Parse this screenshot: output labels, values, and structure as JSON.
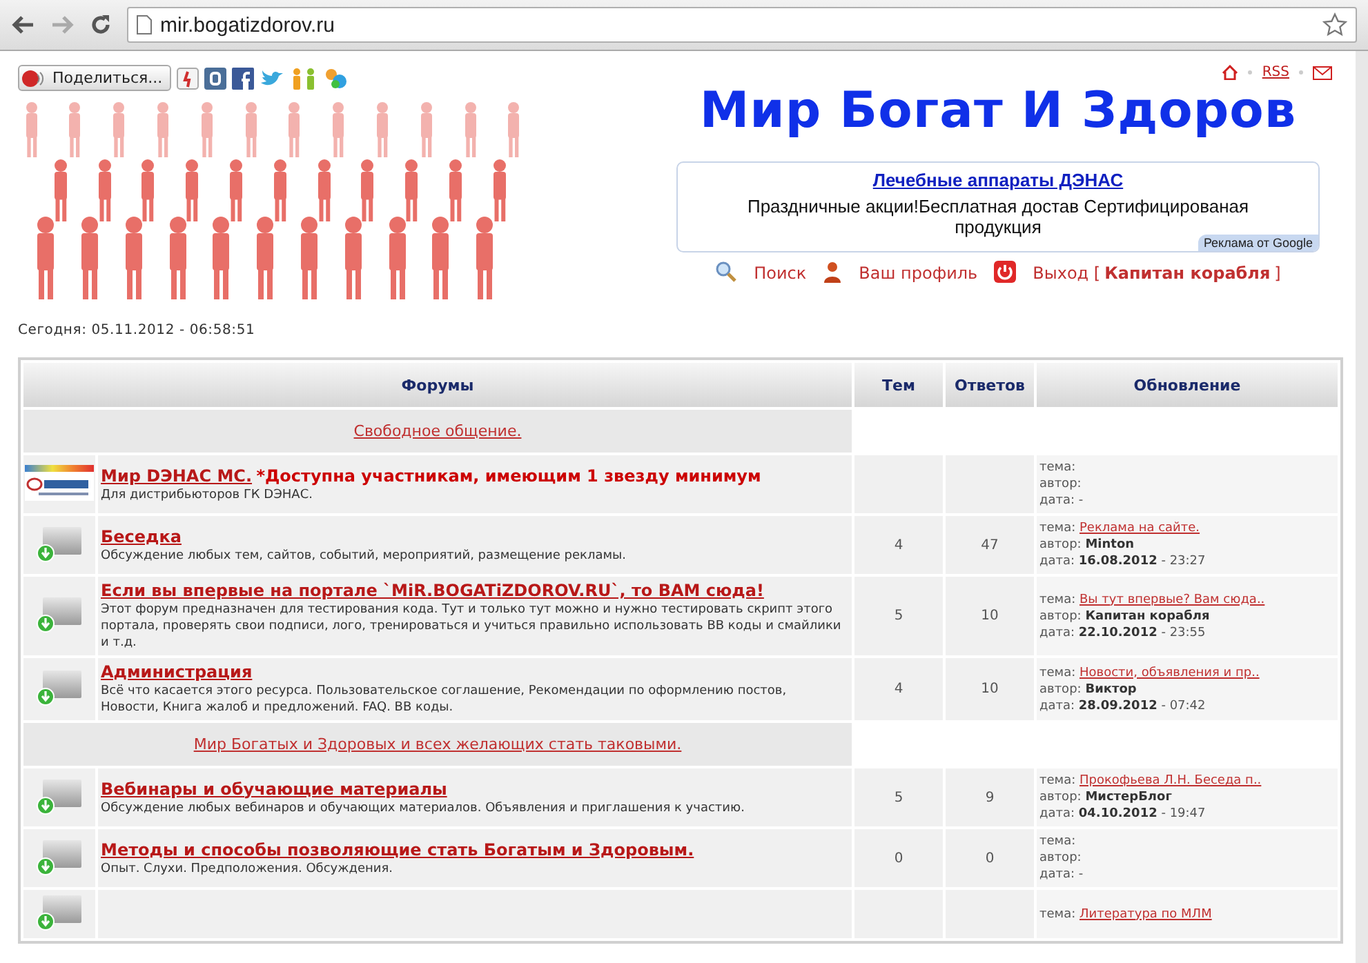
{
  "browser": {
    "url": "mir.bogatizdorov.ru"
  },
  "header": {
    "share_button": "Поделиться...",
    "date": "Сегодня: 05.11.2012 - 06:58:51",
    "rss": "RSS",
    "site_title": "Мир Богат И Здоров",
    "ad": {
      "title": "Лечебные аппараты ДЭНАС",
      "text": "Праздничные акции!Бесплатная достав Сертифицированая продукция",
      "badge": "Реклама от Google"
    },
    "user_links": [
      {
        "kind": "search",
        "label": "Поиск"
      },
      {
        "kind": "profile",
        "label": "Ваш профиль"
      },
      {
        "kind": "logout",
        "label": "Выход [**Капитан корабля**]"
      }
    ]
  },
  "table": {
    "columns": [
      "Форумы",
      "Тем",
      "Ответов",
      "Обновление"
    ],
    "rows": [
      {
        "kind": "category",
        "title": "Свободное общение."
      },
      {
        "kind": "featured",
        "title": "Мир DЭНАС МС.",
        "note": "*Доступна участникам, имеющим 1 звезду минимум",
        "description": "Для дистрибьюторов ГК DЭНАС.",
        "last": [
          {
            "label": "тема:"
          },
          {
            "label": "автор:"
          },
          {
            "label": "дата: -"
          }
        ]
      },
      {
        "kind": "forum",
        "title": "Беседка",
        "description": "Обсуждение любых тем, сайтов, событий, мероприятий, размещение рекламы.",
        "topics": "4",
        "replies": "47",
        "last": [
          {
            "label": "тема:",
            "kind": "link",
            "value": "Реклама на сайте."
          },
          {
            "label": "автор:",
            "kind": "bold",
            "value": "Minton"
          },
          {
            "label": "дата:",
            "kind": "rich",
            "value": "**16.08.2012** - 23:27"
          }
        ]
      },
      {
        "kind": "forum",
        "title": "Если вы впервые на портале `MiR.BOGATiZDOROV.RU`, то ВАМ сюда!",
        "description": "Этот форум предназначен для тестирования кода. Тут и только тут можно и нужно тестировать скрипт этого портала, проверять свои подписи, лого, тренироваться и учиться правильно использовать BB коды и смайлики и т.д.",
        "topics": "5",
        "replies": "10",
        "last": [
          {
            "label": "тема:",
            "kind": "link",
            "value": "Вы тут впервые? Вам сюда.."
          },
          {
            "label": "автор:",
            "kind": "bold",
            "value": "Капитан корабля"
          },
          {
            "label": "дата:",
            "kind": "rich",
            "value": "**22.10.2012** - 23:55"
          }
        ]
      },
      {
        "kind": "forum",
        "title": "Администрация",
        "description": "Всё что касается этого ресурса. Пользовательское соглашение, Рекомендации по оформлению постов, Новости, Книга жалоб и предложений. FAQ. BB коды.",
        "topics": "4",
        "replies": "10",
        "last": [
          {
            "label": "тема:",
            "kind": "link",
            "value": "Новости, объявления и пр.."
          },
          {
            "label": "автор:",
            "kind": "bold",
            "value": "Виктор"
          },
          {
            "label": "дата:",
            "kind": "rich",
            "value": "**28.09.2012** - 07:42"
          }
        ]
      },
      {
        "kind": "category",
        "title": "Мир Богатых и Здоровых и всех желающих стать таковыми."
      },
      {
        "kind": "forum",
        "title": "Вебинары и обучающие материалы",
        "description": "Обсуждение любых вебинаров и обучающих материалов. Объявления и приглашения к участию.",
        "topics": "5",
        "replies": "9",
        "last": [
          {
            "label": "тема:",
            "kind": "link",
            "value": "Прокофьева Л.Н. Беседа п.."
          },
          {
            "label": "автор:",
            "kind": "bold",
            "value": "МистерБлог"
          },
          {
            "label": "дата:",
            "kind": "rich",
            "value": "**04.10.2012** - 19:47"
          }
        ]
      },
      {
        "kind": "forum",
        "title": "Методы и способы позволяющие стать Богатым и Здоровым.",
        "description": "Опыт. Слухи. Предположения. Обсуждения.",
        "topics": "0",
        "replies": "0",
        "last": [
          {
            "label": "тема:"
          },
          {
            "label": "автор:"
          },
          {
            "label": "дата: -"
          }
        ]
      },
      {
        "kind": "forum",
        "last": [
          {
            "label": "тема:",
            "kind": "link",
            "value": "Литература по МЛМ"
          }
        ]
      }
    ]
  }
}
